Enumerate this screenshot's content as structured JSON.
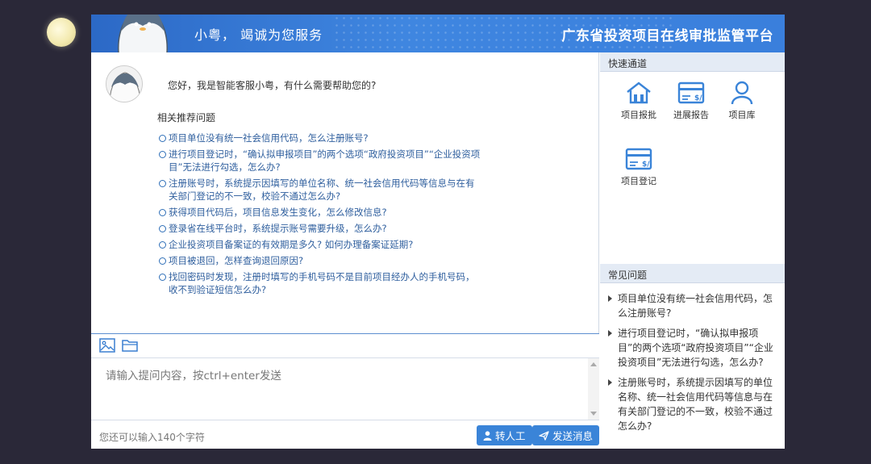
{
  "header": {
    "greeting": "小粤， 竭诚为您服务",
    "title": "广东省投资项目在线审批监管平台"
  },
  "chat": {
    "greeting": "您好，我是智能客服小粤，有什么需要帮助您的?",
    "recommend_title": "相关推荐问题",
    "questions": [
      "项目单位没有统一社会信用代码，怎么注册账号?",
      "进行项目登记时，“确认拟申报项目”的两个选项“政府投资项目”“企业投资项目”无法进行勾选，怎么办?",
      "注册账号时，系统提示因填写的单位名称、统一社会信用代码等信息与在有关部门登记的不一致，校验不通过怎么办?",
      "获得项目代码后，项目信息发生变化，怎么修改信息?",
      "登录省在线平台时，系统提示账号需要升级，怎么办?",
      "企业投资项目备案证的有效期是多久? 如何办理备案证延期?",
      "项目被退回，怎样查询退回原因?",
      "找回密码时发现，注册时填写的手机号码不是目前项目经办人的手机号码，收不到验证短信怎么办?"
    ]
  },
  "input": {
    "placeholder": "请输入提问内容，按ctrl+enter发送",
    "char_count": "您还可以输入140个字符"
  },
  "buttons": {
    "transfer": "转人工",
    "send": "发送消息"
  },
  "quick": {
    "title": "快速通道",
    "items": [
      {
        "label": "项目报批",
        "icon": "house-icon"
      },
      {
        "label": "进展报告",
        "icon": "card-icon"
      },
      {
        "label": "项目库",
        "icon": "person-icon"
      },
      {
        "label": "项目登记",
        "icon": "card-icon"
      }
    ]
  },
  "faq": {
    "title": "常见问题",
    "items": [
      "项目单位没有统一社会信用代码，怎么注册账号?",
      "进行项目登记时，“确认拟申报项目”的两个选项“政府投资项目”“企业投资项目”无法进行勾选，怎么办?",
      "注册账号时，系统提示因填写的单位名称、统一社会信用代码等信息与在有关部门登记的不一致，校验不通过怎么办?"
    ]
  },
  "colors": {
    "header": "#3a7fdc",
    "button": "#3a84d8",
    "link": "#2f5f9e",
    "background": "#2a2838"
  }
}
